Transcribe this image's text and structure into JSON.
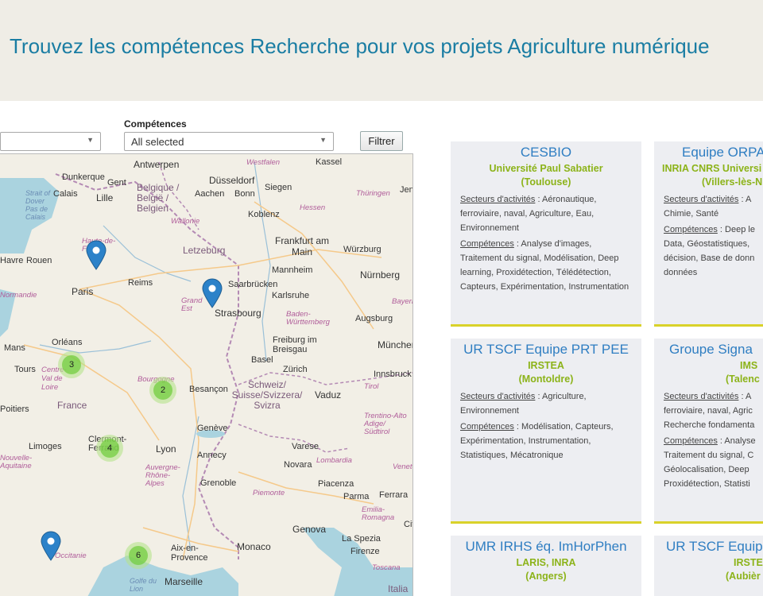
{
  "header": {
    "title": "Trouvez les compétences Recherche pour vos projets Agriculture numérique"
  },
  "filters": {
    "competences_label": "Compétences",
    "competences_value": "All selected",
    "filter_button": "Filtrer"
  },
  "map": {
    "cities": [
      "Antwerpen",
      "Düsseldorf",
      "Dunkerque",
      "Gent",
      "Kassel",
      "Westfalen",
      "Siegen",
      "Calais",
      "Lille",
      "Belgique / België / Belgien",
      "Aachen",
      "Bonn",
      "Thüringen",
      "Jena",
      "Koblenz",
      "Hessen",
      "Wallonie",
      "Frankfurt am Main",
      "Würzburg",
      "Letzeburg",
      "Mannheim",
      "Nürnberg",
      "Havre",
      "Rouen",
      "Paris",
      "Reims",
      "Saarbrücken",
      "Karlsruhe",
      "Strasbourg",
      "Grand Est",
      "Baden-Württemberg",
      "Augsburg",
      "Bayern",
      "Mans",
      "Orléans",
      "Freiburg im Breisgau",
      "München",
      "Tours",
      "Centre-Val de Loire",
      "Basel",
      "Zürich",
      "Innsbruck",
      "Bourgogne",
      "Besançon",
      "Schweiz/ Suisse/Svizzera/ Svizra",
      "Vaduz",
      "Tirol",
      "Poitiers",
      "France",
      "Trentino-Alto Adige/ Südtirol",
      "Limoges",
      "Clermont-Ferrand",
      "Lyon",
      "Genève",
      "Annecy",
      "Varese",
      "Nouvelle-Aquitaine",
      "Auvergne-Rhône-Alpes",
      "Novara",
      "Lombardia",
      "Veneto",
      "Grenoble",
      "Piacenza",
      "Piemonte",
      "Parma",
      "Ferrara",
      "Emilia-Romagna",
      "Genova",
      "La Spezia",
      "Monaco",
      "Aix-en-Provence",
      "Firenze",
      "Occitanie",
      "Marseille",
      "Toscana",
      "Italia",
      "Strait of Dover Pas de Calais",
      "Golfe du Lion",
      "Normandie",
      "Haute-de-France",
      "Cit"
    ],
    "clusters": [
      {
        "count": "3"
      },
      {
        "count": "2"
      },
      {
        "count": "4"
      },
      {
        "count": "6"
      }
    ]
  },
  "cards": [
    {
      "title": "CESBIO",
      "org": "Université Paul Sabatier",
      "city": "(Toulouse)",
      "sect_label": "Secteurs d'activités",
      "sect_value": " : Aéronautique, ferroviaire, naval, Agriculture, Eau, Environnement",
      "comp_label": "Compétences",
      "comp_value": " : Analyse d'images, Traitement du signal, Modélisation, Deep learning, Proxidétection, Télédétection, Capteurs, Expérimentation, Instrumentation"
    },
    {
      "title": "Equipe ORPA",
      "org": "INRIA CNRS Universi",
      "city": "(Villers-lès-N",
      "sect_label": "Secteurs d'activités",
      "sect_value": " : A Chimie, Santé",
      "comp_label": "Compétences",
      "comp_value": " : Deep le Data, Géostatistiques, décision, Base de donn données"
    },
    {
      "title": "UR TSCF Equipe PRT PEE",
      "org": "IRSTEA",
      "city": "(Montoldre)",
      "sect_label": "Secteurs d'activités",
      "sect_value": " : Agriculture, Environnement",
      "comp_label": "Compétences",
      "comp_value": " : Modélisation, Capteurs, Expérimentation, Instrumentation, Statistiques, Mécatronique"
    },
    {
      "title": "Groupe Signa",
      "org": "IMS",
      "city": "(Talenc",
      "sect_label": "Secteurs d'activités",
      "sect_value": " : A ferroviaire, naval, Agric Recherche fondamenta",
      "comp_label": "Compétences",
      "comp_value": " : Analyse Traitement du signal, C Géolocalisation, Deep Proxidétection, Statisti"
    },
    {
      "title": "UMR IRHS éq. ImHorPhen",
      "org": "LARIS, INRA",
      "city": "(Angers)"
    },
    {
      "title": "UR TSCF Equip",
      "org": "IRSTEA",
      "city": "(Aubièr"
    }
  ],
  "colors": {
    "title": "#1a7da3",
    "card_title": "#2f7ec2",
    "card_org": "#8cb319",
    "card_border": "#d9d22a",
    "pin": "#2c82c9"
  }
}
